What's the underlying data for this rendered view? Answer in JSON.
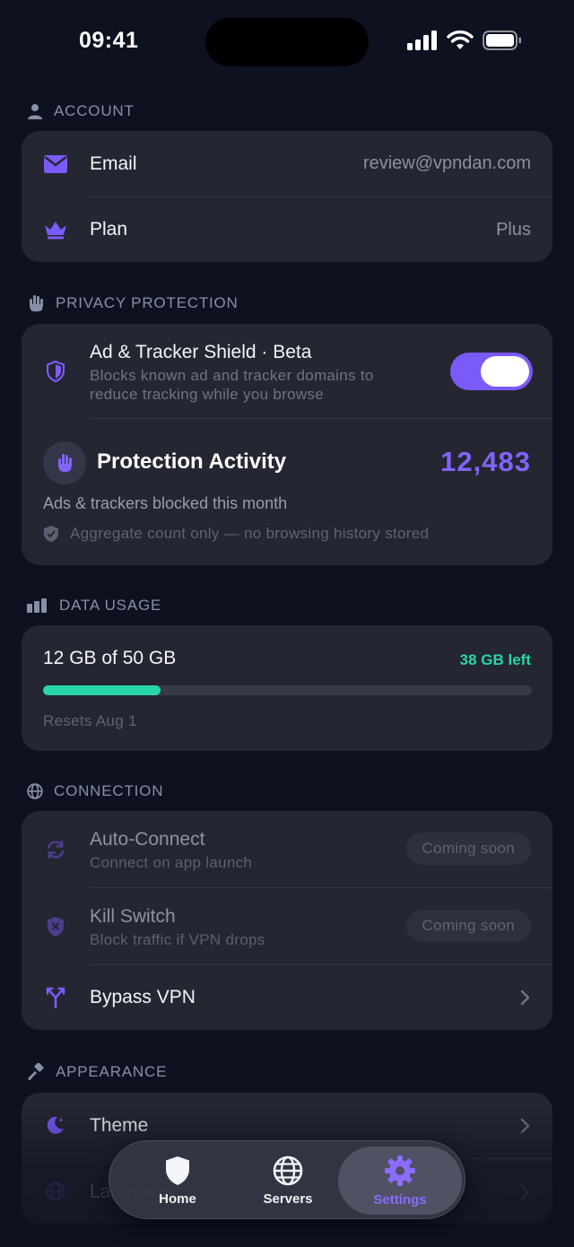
{
  "status_bar": {
    "time": "09:41"
  },
  "account": {
    "header": "ACCOUNT",
    "email_label": "Email",
    "email_value": "review@vpndan.com",
    "plan_label": "Plan",
    "plan_value": "Plus"
  },
  "privacy": {
    "header": "PRIVACY PROTECTION",
    "shield_title": "Ad & Tracker Shield · Beta",
    "shield_sub_line1": "Blocks known ad and tracker domains to",
    "shield_sub_line2": "reduce tracking while you browse",
    "shield_enabled": true,
    "activity_title": "Protection Activity",
    "activity_count": "12,483",
    "activity_caption": "Ads & trackers blocked this month",
    "activity_note": "Aggregate count only — no browsing history stored"
  },
  "data_usage": {
    "header": "DATA USAGE",
    "used_text": "12 GB of 50 GB",
    "left_text": "38 GB left",
    "used_fraction": 0.24,
    "reset_text": "Resets Aug 1"
  },
  "connection": {
    "header": "CONNECTION",
    "auto_title": "Auto-Connect",
    "auto_sub": "Connect on app launch",
    "auto_badge": "Coming soon",
    "kill_title": "Kill Switch",
    "kill_sub": "Block traffic if VPN drops",
    "kill_badge": "Coming soon",
    "bypass_title": "Bypass VPN"
  },
  "appearance": {
    "header": "APPEARANCE",
    "theme_title": "Theme",
    "language_title": "Language"
  },
  "tabs": [
    {
      "label": "Home",
      "icon": "shield-icon"
    },
    {
      "label": "Servers",
      "icon": "globe-icon"
    },
    {
      "label": "Settings",
      "icon": "gear-icon",
      "active": true
    }
  ],
  "colors": {
    "accent": "#7a5af8",
    "success": "#27d7a9",
    "background": "#0d1120",
    "card": "#242631"
  }
}
